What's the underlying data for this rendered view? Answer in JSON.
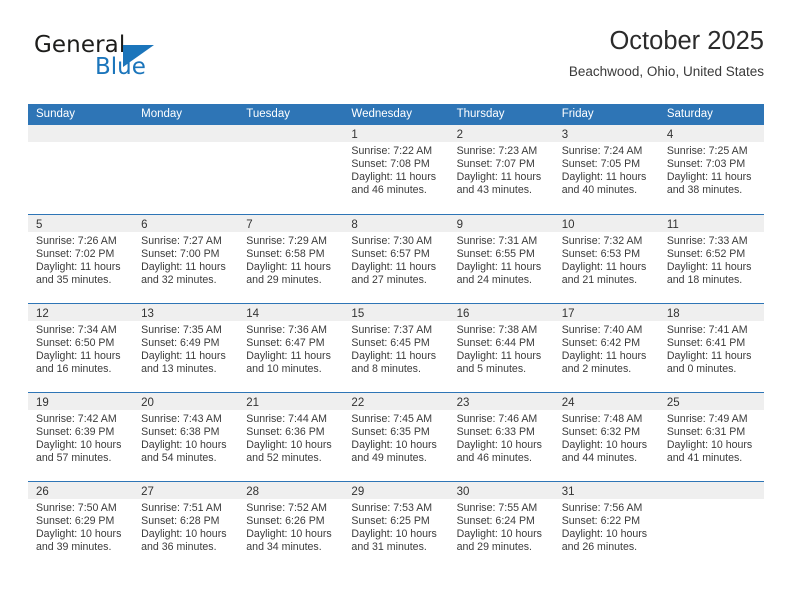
{
  "brand": {
    "name_top": "General",
    "name_bottom": "Blue",
    "accent_color": "#1b75bb"
  },
  "header": {
    "title": "October 2025",
    "subtitle": "Beachwood, Ohio, United States",
    "header_bg_color": "#2e75b6",
    "daynum_band_color": "#efefef"
  },
  "weekdays": [
    "Sunday",
    "Monday",
    "Tuesday",
    "Wednesday",
    "Thursday",
    "Friday",
    "Saturday"
  ],
  "labels": {
    "sunrise": "Sunrise:",
    "sunset": "Sunset:",
    "daylight": "Daylight:"
  },
  "weeks": [
    [
      {
        "day": "",
        "empty": true
      },
      {
        "day": "",
        "empty": true
      },
      {
        "day": "",
        "empty": true
      },
      {
        "day": "1",
        "sunrise": "Sunrise: 7:22 AM",
        "sunset": "Sunset: 7:08 PM",
        "daylight_1": "Daylight: 11 hours",
        "daylight_2": "and 46 minutes."
      },
      {
        "day": "2",
        "sunrise": "Sunrise: 7:23 AM",
        "sunset": "Sunset: 7:07 PM",
        "daylight_1": "Daylight: 11 hours",
        "daylight_2": "and 43 minutes."
      },
      {
        "day": "3",
        "sunrise": "Sunrise: 7:24 AM",
        "sunset": "Sunset: 7:05 PM",
        "daylight_1": "Daylight: 11 hours",
        "daylight_2": "and 40 minutes."
      },
      {
        "day": "4",
        "sunrise": "Sunrise: 7:25 AM",
        "sunset": "Sunset: 7:03 PM",
        "daylight_1": "Daylight: 11 hours",
        "daylight_2": "and 38 minutes."
      }
    ],
    [
      {
        "day": "5",
        "sunrise": "Sunrise: 7:26 AM",
        "sunset": "Sunset: 7:02 PM",
        "daylight_1": "Daylight: 11 hours",
        "daylight_2": "and 35 minutes."
      },
      {
        "day": "6",
        "sunrise": "Sunrise: 7:27 AM",
        "sunset": "Sunset: 7:00 PM",
        "daylight_1": "Daylight: 11 hours",
        "daylight_2": "and 32 minutes."
      },
      {
        "day": "7",
        "sunrise": "Sunrise: 7:29 AM",
        "sunset": "Sunset: 6:58 PM",
        "daylight_1": "Daylight: 11 hours",
        "daylight_2": "and 29 minutes."
      },
      {
        "day": "8",
        "sunrise": "Sunrise: 7:30 AM",
        "sunset": "Sunset: 6:57 PM",
        "daylight_1": "Daylight: 11 hours",
        "daylight_2": "and 27 minutes."
      },
      {
        "day": "9",
        "sunrise": "Sunrise: 7:31 AM",
        "sunset": "Sunset: 6:55 PM",
        "daylight_1": "Daylight: 11 hours",
        "daylight_2": "and 24 minutes."
      },
      {
        "day": "10",
        "sunrise": "Sunrise: 7:32 AM",
        "sunset": "Sunset: 6:53 PM",
        "daylight_1": "Daylight: 11 hours",
        "daylight_2": "and 21 minutes."
      },
      {
        "day": "11",
        "sunrise": "Sunrise: 7:33 AM",
        "sunset": "Sunset: 6:52 PM",
        "daylight_1": "Daylight: 11 hours",
        "daylight_2": "and 18 minutes."
      }
    ],
    [
      {
        "day": "12",
        "sunrise": "Sunrise: 7:34 AM",
        "sunset": "Sunset: 6:50 PM",
        "daylight_1": "Daylight: 11 hours",
        "daylight_2": "and 16 minutes."
      },
      {
        "day": "13",
        "sunrise": "Sunrise: 7:35 AM",
        "sunset": "Sunset: 6:49 PM",
        "daylight_1": "Daylight: 11 hours",
        "daylight_2": "and 13 minutes."
      },
      {
        "day": "14",
        "sunrise": "Sunrise: 7:36 AM",
        "sunset": "Sunset: 6:47 PM",
        "daylight_1": "Daylight: 11 hours",
        "daylight_2": "and 10 minutes."
      },
      {
        "day": "15",
        "sunrise": "Sunrise: 7:37 AM",
        "sunset": "Sunset: 6:45 PM",
        "daylight_1": "Daylight: 11 hours",
        "daylight_2": "and 8 minutes."
      },
      {
        "day": "16",
        "sunrise": "Sunrise: 7:38 AM",
        "sunset": "Sunset: 6:44 PM",
        "daylight_1": "Daylight: 11 hours",
        "daylight_2": "and 5 minutes."
      },
      {
        "day": "17",
        "sunrise": "Sunrise: 7:40 AM",
        "sunset": "Sunset: 6:42 PM",
        "daylight_1": "Daylight: 11 hours",
        "daylight_2": "and 2 minutes."
      },
      {
        "day": "18",
        "sunrise": "Sunrise: 7:41 AM",
        "sunset": "Sunset: 6:41 PM",
        "daylight_1": "Daylight: 11 hours",
        "daylight_2": "and 0 minutes."
      }
    ],
    [
      {
        "day": "19",
        "sunrise": "Sunrise: 7:42 AM",
        "sunset": "Sunset: 6:39 PM",
        "daylight_1": "Daylight: 10 hours",
        "daylight_2": "and 57 minutes."
      },
      {
        "day": "20",
        "sunrise": "Sunrise: 7:43 AM",
        "sunset": "Sunset: 6:38 PM",
        "daylight_1": "Daylight: 10 hours",
        "daylight_2": "and 54 minutes."
      },
      {
        "day": "21",
        "sunrise": "Sunrise: 7:44 AM",
        "sunset": "Sunset: 6:36 PM",
        "daylight_1": "Daylight: 10 hours",
        "daylight_2": "and 52 minutes."
      },
      {
        "day": "22",
        "sunrise": "Sunrise: 7:45 AM",
        "sunset": "Sunset: 6:35 PM",
        "daylight_1": "Daylight: 10 hours",
        "daylight_2": "and 49 minutes."
      },
      {
        "day": "23",
        "sunrise": "Sunrise: 7:46 AM",
        "sunset": "Sunset: 6:33 PM",
        "daylight_1": "Daylight: 10 hours",
        "daylight_2": "and 46 minutes."
      },
      {
        "day": "24",
        "sunrise": "Sunrise: 7:48 AM",
        "sunset": "Sunset: 6:32 PM",
        "daylight_1": "Daylight: 10 hours",
        "daylight_2": "and 44 minutes."
      },
      {
        "day": "25",
        "sunrise": "Sunrise: 7:49 AM",
        "sunset": "Sunset: 6:31 PM",
        "daylight_1": "Daylight: 10 hours",
        "daylight_2": "and 41 minutes."
      }
    ],
    [
      {
        "day": "26",
        "sunrise": "Sunrise: 7:50 AM",
        "sunset": "Sunset: 6:29 PM",
        "daylight_1": "Daylight: 10 hours",
        "daylight_2": "and 39 minutes."
      },
      {
        "day": "27",
        "sunrise": "Sunrise: 7:51 AM",
        "sunset": "Sunset: 6:28 PM",
        "daylight_1": "Daylight: 10 hours",
        "daylight_2": "and 36 minutes."
      },
      {
        "day": "28",
        "sunrise": "Sunrise: 7:52 AM",
        "sunset": "Sunset: 6:26 PM",
        "daylight_1": "Daylight: 10 hours",
        "daylight_2": "and 34 minutes."
      },
      {
        "day": "29",
        "sunrise": "Sunrise: 7:53 AM",
        "sunset": "Sunset: 6:25 PM",
        "daylight_1": "Daylight: 10 hours",
        "daylight_2": "and 31 minutes."
      },
      {
        "day": "30",
        "sunrise": "Sunrise: 7:55 AM",
        "sunset": "Sunset: 6:24 PM",
        "daylight_1": "Daylight: 10 hours",
        "daylight_2": "and 29 minutes."
      },
      {
        "day": "31",
        "sunrise": "Sunrise: 7:56 AM",
        "sunset": "Sunset: 6:22 PM",
        "daylight_1": "Daylight: 10 hours",
        "daylight_2": "and 26 minutes."
      },
      {
        "day": "",
        "empty": true
      }
    ]
  ]
}
